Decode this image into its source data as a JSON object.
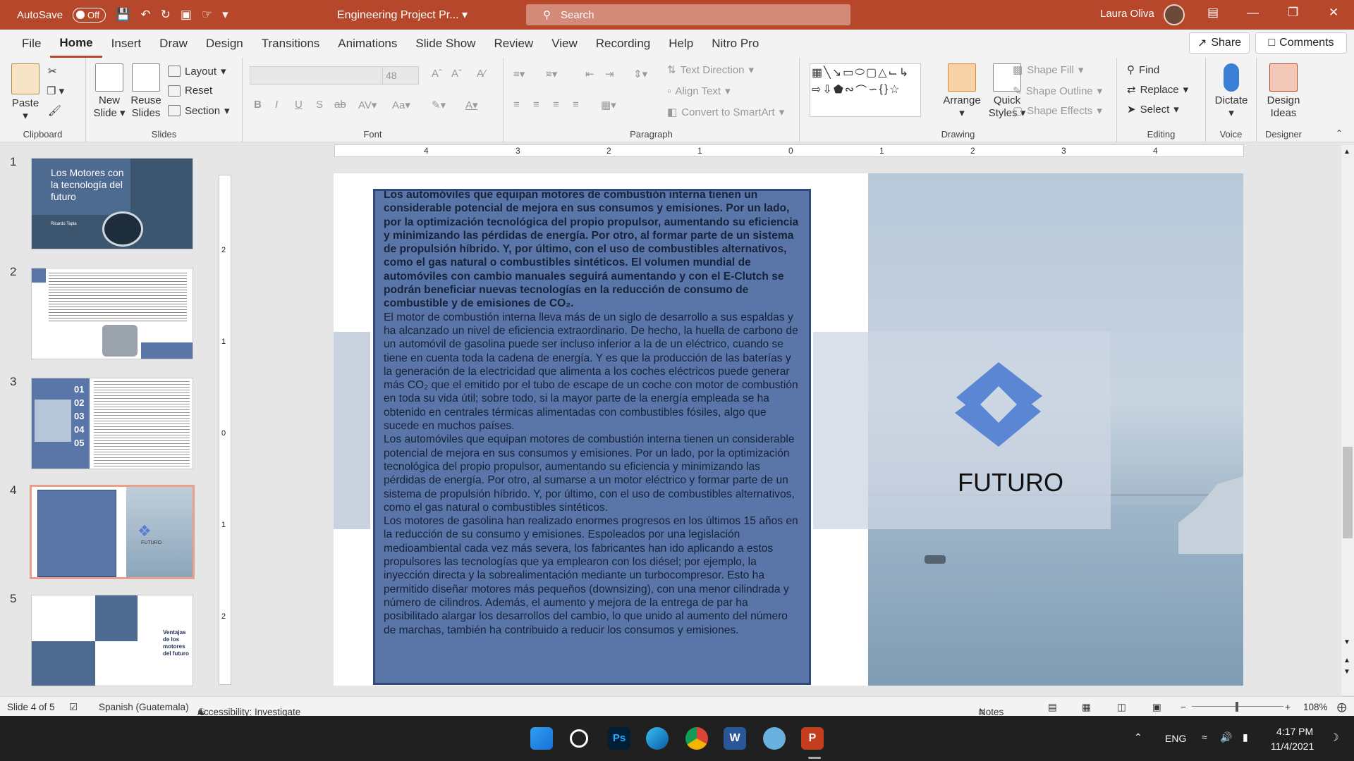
{
  "titlebar": {
    "autosave_label": "AutoSave",
    "autosave_state": "Off",
    "doc_title": "Engineering Project Pr...",
    "search_placeholder": "Search",
    "user_name": "Laura Oliva",
    "accent": "#b7472a"
  },
  "menu": {
    "tabs": [
      "File",
      "Home",
      "Insert",
      "Draw",
      "Design",
      "Transitions",
      "Animations",
      "Slide Show",
      "Review",
      "View",
      "Recording",
      "Help",
      "Nitro Pro"
    ],
    "active": "Home",
    "share_label": "Share",
    "comments_label": "Comments"
  },
  "ribbon": {
    "clipboard": {
      "label": "Clipboard",
      "paste": "Paste"
    },
    "slides": {
      "label": "Slides",
      "new_slide": "New Slide",
      "reuse_slides": "Reuse Slides",
      "layout": "Layout",
      "reset": "Reset",
      "section": "Section"
    },
    "font": {
      "label": "Font",
      "size": "48"
    },
    "paragraph": {
      "label": "Paragraph",
      "text_direction": "Text Direction",
      "align_text": "Align Text",
      "convert_smartart": "Convert to SmartArt"
    },
    "drawing": {
      "label": "Drawing",
      "arrange": "Arrange",
      "quick_styles": "Quick Styles",
      "shape_fill": "Shape Fill",
      "shape_outline": "Shape Outline",
      "shape_effects": "Shape Effects"
    },
    "editing": {
      "label": "Editing",
      "find": "Find",
      "replace": "Replace",
      "select": "Select"
    },
    "voice": {
      "label": "Voice",
      "dictate": "Dictate"
    },
    "designer": {
      "label": "Designer",
      "design_ideas": "Design Ideas"
    }
  },
  "thumbnails": [
    {
      "num": "1",
      "title": "Los Motores con la tecnología del futuro",
      "subtitle": "Ricardo Tapia"
    },
    {
      "num": "2"
    },
    {
      "num": "3",
      "items": [
        "01",
        "02",
        "03",
        "04",
        "05"
      ]
    },
    {
      "num": "4",
      "logo": "FUTURO"
    },
    {
      "num": "5",
      "title": "Ventajas de los motores del futuro"
    }
  ],
  "ruler": {
    "h_ticks": [
      "4",
      "3",
      "2",
      "1",
      "0",
      "1",
      "2",
      "3",
      "4"
    ],
    "v_ticks": [
      "2",
      "1",
      "0",
      "1",
      "2"
    ]
  },
  "slide": {
    "logo_text": "FUTURO",
    "bold_paragraph": "Los automóviles que equipan motores de combustión interna tienen un considerable potencial de mejora en sus consumos y emisiones. Por un lado, por la optimización tecnológica del propio propulsor, aumentando su eficiencia y minimizando las pérdidas de energía. Por otro, al formar parte de un sistema de propulsión híbrido. Y, por último, con el uso de combustibles alternativos, como el gas natural o combustibles sintéticos. El volumen mundial de automóviles con cambio manuales seguirá aumentando y con el E-Clutch se podrán beneficiar nuevas tecnologías en la reducción de consumo de combustible y de emisiones de CO₂.",
    "paragraph_2": "El motor de combustión interna lleva más de un siglo de desarrollo a sus espaldas y ha alcanzado un nivel de eficiencia extraordinario. De hecho, la huella de carbono de un automóvil de gasolina puede ser incluso inferior a la de un eléctrico, cuando se tiene en cuenta toda la cadena de energía. Y es que la producción de las baterías y la generación de la electricidad que alimenta a los coches eléctricos puede generar más CO₂ que el emitido por el tubo de escape de un coche con motor de combustión en toda su vida útil; sobre todo, si la mayor parte de la energía empleada se ha obtenido en centrales térmicas alimentadas con combustibles fósiles, algo que sucede en muchos países.",
    "paragraph_3": "Los automóviles que equipan motores de combustión interna tienen un considerable potencial de mejora en sus consumos y emisiones. Por un lado, por la optimización tecnológica del propio propulsor, aumentando su eficiencia y minimizando las pérdidas de energía. Por otro, al sumarse a un motor eléctrico y formar parte de un sistema de propulsión híbrido. Y, por último, con el uso de combustibles alternativos, como el gas natural o combustibles sintéticos.",
    "paragraph_4": "Los motores de gasolina han realizado enormes progresos en los últimos 15 años en la reducción de su consumo y emisiones. Espoleados por una legislación medioambiental cada vez más severa, los fabricantes han ido aplicando a estos propulsores las tecnologías que ya emplearon con los diésel; por ejemplo, la inyección directa y la sobrealimentación mediante un turbocompresor. Esto ha permitido diseñar motores más pequeños (downsizing), con una menor cilindrada y número de cilindros. Además, el aumento y mejora de la entrega de par ha posibilitado alargar los desarrollos del cambio, lo que unido al aumento del número de marchas, también ha contribuido a reducir los consumos y emisiones."
  },
  "status": {
    "slide_info": "Slide 4 of 5",
    "language": "Spanish (Guatemala)",
    "accessibility": "Accessibility: Investigate",
    "notes": "Notes",
    "zoom": "108%"
  },
  "taskbar": {
    "lang": "ENG",
    "time": "4:17 PM",
    "date": "11/4/2021"
  }
}
